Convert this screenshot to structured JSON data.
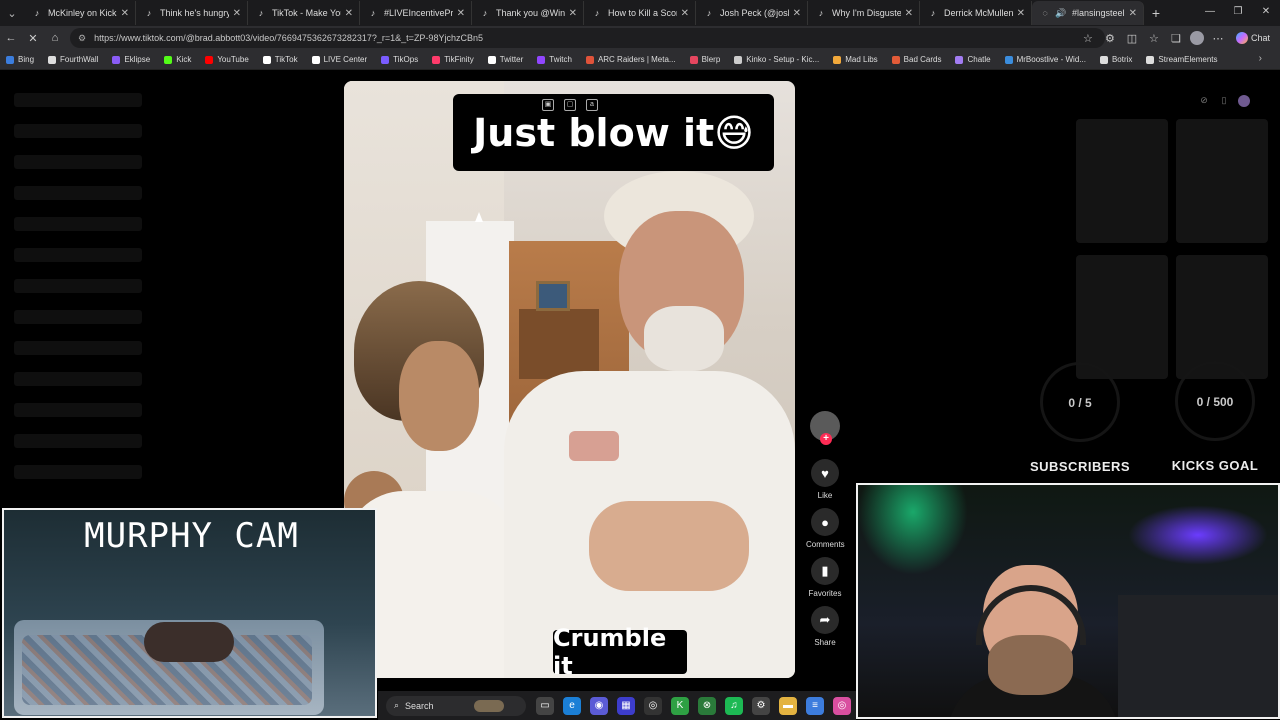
{
  "browser": {
    "tabs": [
      {
        "title": "McKinley on Kick (@m",
        "active": false
      },
      {
        "title": "Think he's hungry 😂",
        "active": false
      },
      {
        "title": "TikTok - Make Your Da",
        "active": false
      },
      {
        "title": "#LIVEIncentiveProgram",
        "active": false
      },
      {
        "title": "Thank you @Window",
        "active": false
      },
      {
        "title": "How to Kill a Scorpion",
        "active": false
      },
      {
        "title": "Josh Peck (@joshpeck)",
        "active": false
      },
      {
        "title": "Why I'm Disgusted —",
        "active": false
      },
      {
        "title": "Derrick McMullen (@d",
        "active": false
      },
      {
        "title": "#lansingsteel #fyp",
        "active": true
      }
    ],
    "new_tab": "+",
    "url": "https://www.tiktok.com/@brad.abbott03/video/7669475362673282317?_r=1&_t=ZP-98YjchzCBn5",
    "chat_label": "Chat",
    "bookmarks": [
      {
        "label": "Bing",
        "color": "#3b7ddd"
      },
      {
        "label": "FourthWall",
        "color": "#dddddd"
      },
      {
        "label": "Eklipse",
        "color": "#8a5cf6"
      },
      {
        "label": "Kick",
        "color": "#53fc18"
      },
      {
        "label": "YouTube",
        "color": "#ff0000"
      },
      {
        "label": "TikTok",
        "color": "#ffffff"
      },
      {
        "label": "LIVE Center",
        "color": "#ffffff"
      },
      {
        "label": "TikOps",
        "color": "#7a5cff"
      },
      {
        "label": "TikFinity",
        "color": "#ff3b6b"
      },
      {
        "label": "Twitter",
        "color": "#ffffff"
      },
      {
        "label": "Twitch",
        "color": "#9146ff"
      },
      {
        "label": "ARC Raiders | Meta...",
        "color": "#e0533a"
      },
      {
        "label": "Blerp",
        "color": "#e6465f"
      },
      {
        "label": "Kinko - Setup - Kic...",
        "color": "#cccccc"
      },
      {
        "label": "Mad Libs",
        "color": "#f2a93b"
      },
      {
        "label": "Bad Cards",
        "color": "#e25b38"
      },
      {
        "label": "Chatle",
        "color": "#a27cf2"
      },
      {
        "label": "MrBoostlive - Wid...",
        "color": "#3b8ddd"
      },
      {
        "label": "Botrix",
        "color": "#dddddd"
      },
      {
        "label": "StreamElements",
        "color": "#dddddd"
      }
    ]
  },
  "video": {
    "caption_top": "Just blow it😅",
    "caption_bottom": "Crumble it"
  },
  "actions": {
    "follow_plus": "+",
    "like": "Like",
    "comments": "Comments",
    "favorites": "Favorites",
    "share": "Share"
  },
  "goals": {
    "subscribers_count": "0 / 5",
    "subscribers_label": "SUBSCRIBERS",
    "kicks_count": "0 / 500",
    "kicks_label": "KICKS GOAL"
  },
  "murphy_cam": {
    "title": "MURPHY CAM"
  },
  "taskbar": {
    "search_label": "Search"
  },
  "icons": {
    "back": "back-arrow-icon",
    "forward": "forward-arrow-icon",
    "reload": "reload-icon",
    "home": "home-icon"
  }
}
